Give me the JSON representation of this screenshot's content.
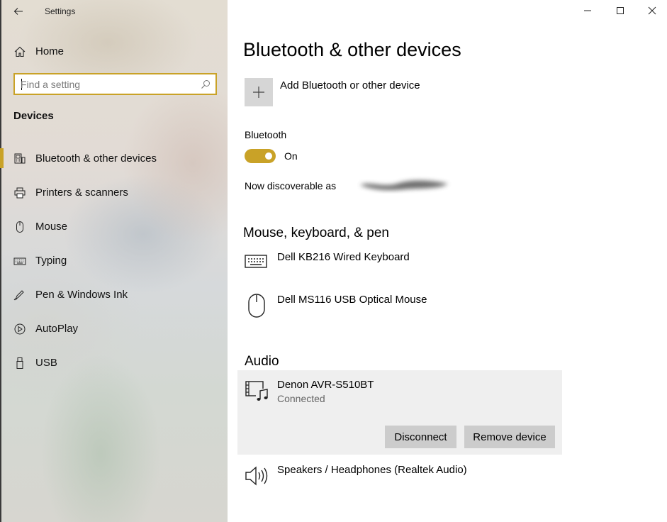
{
  "app": {
    "title": "Settings"
  },
  "sidebar": {
    "home_label": "Home",
    "search": {
      "placeholder": "Find a setting",
      "value": ""
    },
    "section_title": "Devices",
    "items": [
      {
        "label": "Bluetooth & other devices",
        "icon": "bluetooth-devices-icon",
        "active": true
      },
      {
        "label": "Printers & scanners",
        "icon": "printer-icon",
        "active": false
      },
      {
        "label": "Mouse",
        "icon": "mouse-icon",
        "active": false
      },
      {
        "label": "Typing",
        "icon": "keyboard-icon",
        "active": false
      },
      {
        "label": "Pen & Windows Ink",
        "icon": "pen-icon",
        "active": false
      },
      {
        "label": "AutoPlay",
        "icon": "autoplay-icon",
        "active": false
      },
      {
        "label": "USB",
        "icon": "usb-icon",
        "active": false
      }
    ]
  },
  "main": {
    "title": "Bluetooth & other devices",
    "add_device_label": "Add Bluetooth or other device",
    "bluetooth": {
      "label": "Bluetooth",
      "toggle_state": "On",
      "toggle_on": true,
      "discoverable_label": "Now discoverable as"
    },
    "groups": [
      {
        "title": "Mouse, keyboard, & pen",
        "devices": [
          {
            "name": "Dell KB216 Wired Keyboard",
            "icon": "keyboard-icon"
          },
          {
            "name": "Dell MS116 USB Optical Mouse",
            "icon": "mouse-icon"
          }
        ]
      },
      {
        "title": "Audio",
        "devices": [
          {
            "name": "Denon AVR-S510BT",
            "status": "Connected",
            "icon": "media-device-icon",
            "selected": true
          },
          {
            "name": "Speakers / Headphones (Realtek Audio)",
            "icon": "speaker-icon"
          }
        ]
      }
    ],
    "buttons": {
      "disconnect": "Disconnect",
      "remove": "Remove device"
    }
  },
  "colors": {
    "accent": "#c9a227",
    "button_bg": "#cccccc",
    "selected_bg": "#efefef"
  }
}
